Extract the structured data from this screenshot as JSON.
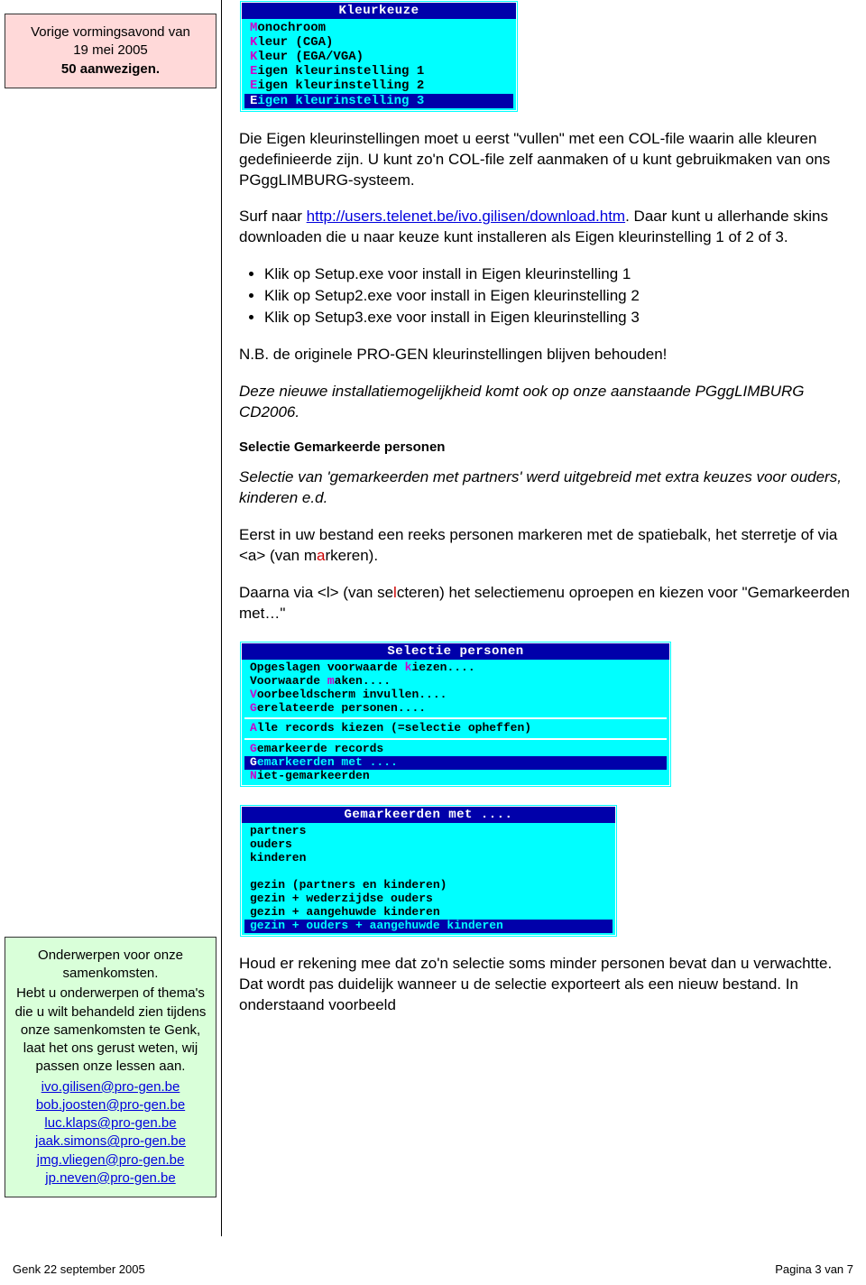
{
  "sidebar": {
    "box1": {
      "line1": "Vorige vormingsavond van",
      "line2": "19 mei 2005",
      "line3": "50 aanwezigen."
    },
    "box2": {
      "line1": "Onderwerpen voor onze samenkomsten.",
      "line2": "Hebt u onderwerpen of thema's die u wilt behandeld zien tijdens onze samenkomsten te Genk, laat het ons gerust weten, wij passen onze lessen aan.",
      "emails": [
        "ivo.gilisen@pro-gen.be",
        "bob.joosten@pro-gen.be",
        "luc.klaps@pro-gen.be",
        "jaak.simons@pro-gen.be",
        "jmg.vliegen@pro-gen.be",
        "jp.neven@pro-gen.be"
      ]
    }
  },
  "dos1": {
    "title": "Kleurkeuze",
    "items": [
      {
        "hot": "M",
        "rest": "onochroom",
        "sel": false
      },
      {
        "hot": "K",
        "rest": "leur (CGA)",
        "sel": false
      },
      {
        "hot": "K",
        "rest": "leur (EGA/VGA)",
        "sel": false
      },
      {
        "hot": "E",
        "rest": "igen kleurinstelling 1",
        "sel": false
      },
      {
        "hot": "E",
        "rest": "igen kleurinstelling 2",
        "sel": false
      },
      {
        "hot": "E",
        "rest": "igen kleurinstelling 3",
        "sel": true
      }
    ]
  },
  "p1a": "Die Eigen kleurinstellingen moet u eerst \"vullen\" met een COL-file waarin alle kleuren gedefinieerde zijn.",
  "p1b": "U kunt zo'n COL-file zelf aanmaken of u kunt gebruikmaken van ons PGggLIMBURG-systeem.",
  "p2a": "Surf naar ",
  "p2link": "http://users.telenet.be/ivo.gilisen/download.htm",
  "p2b": ". Daar kunt u allerhande skins downloaden die u naar keuze kunt installeren als Eigen kleurinstelling 1 of 2 of 3.",
  "bullets": [
    "Klik op Setup.exe  voor install in Eigen kleurinstelling 1",
    "Klik op Setup2.exe voor install in Eigen kleurinstelling 2",
    "Klik op Setup3.exe voor install in Eigen kleurinstelling 3"
  ],
  "p3": "N.B. de originele PRO-GEN kleurinstellingen blijven behouden!",
  "p4": "Deze nieuwe installatiemogelijkheid komt ook op onze aanstaande PGggLIMBURG CD2006.",
  "h1": "Selectie Gemarkeerde personen",
  "p5": "Selectie van 'gemarkeerden met partners' werd uitgebreid met extra keuzes voor ouders, kinderen e.d.",
  "p6a": "Eerst in uw bestand een reeks personen markeren met de spatiebalk, het sterretje of via <a> (van m",
  "p6red": "a",
  "p6b": "rkeren).",
  "p7a": "Daarna via <l> (van se",
  "p7red": "l",
  "p7b": "cteren) het selectiemenu oproepen en kiezen voor \"Gemarkeerden met…\"",
  "dos2": {
    "title": "Selectie personen",
    "g1": [
      {
        "pre": "Opgeslagen voorwaarde ",
        "hot": "k",
        "post": "iezen...."
      },
      {
        "pre": "Voorwaarde ",
        "hot": "m",
        "post": "aken...."
      },
      {
        "pre": "",
        "hot": "V",
        "post": "oorbeeldscherm invullen...."
      },
      {
        "pre": "",
        "hot": "G",
        "post": "erelateerde personen...."
      }
    ],
    "g2": [
      {
        "pre": "",
        "hot": "A",
        "post": "lle records kiezen (=selectie opheffen)"
      }
    ],
    "g3": [
      {
        "pre": "",
        "hot": "G",
        "post": "emarkeerde records",
        "sel": false
      },
      {
        "pre": "",
        "hot": "G",
        "post": "emarkeerden met ....",
        "sel": true
      },
      {
        "pre": "",
        "hot": "N",
        "post": "iet-gemarkeerden",
        "sel": false
      }
    ]
  },
  "dos3": {
    "title": "Gemarkeerden met ....",
    "items": [
      {
        "t": "partners",
        "sel": false
      },
      {
        "t": "ouders",
        "sel": false
      },
      {
        "t": "kinderen",
        "sel": false
      },
      {
        "t": "",
        "sel": false
      },
      {
        "t": "gezin (partners en kinderen)",
        "sel": false
      },
      {
        "t": "gezin + wederzijdse ouders",
        "sel": false
      },
      {
        "t": "gezin + aangehuwde kinderen",
        "sel": false
      },
      {
        "t": "gezin + ouders + aangehuwde kinderen",
        "sel": true
      }
    ]
  },
  "p8": "Houd er rekening mee dat zo'n selectie soms minder personen bevat dan u verwachtte. Dat wordt pas duidelijk wanneer u de selectie exporteert als een nieuw bestand. In onderstaand voorbeeld",
  "footer": {
    "left": "Genk 22 september 2005",
    "right": "Pagina 3 van 7"
  }
}
